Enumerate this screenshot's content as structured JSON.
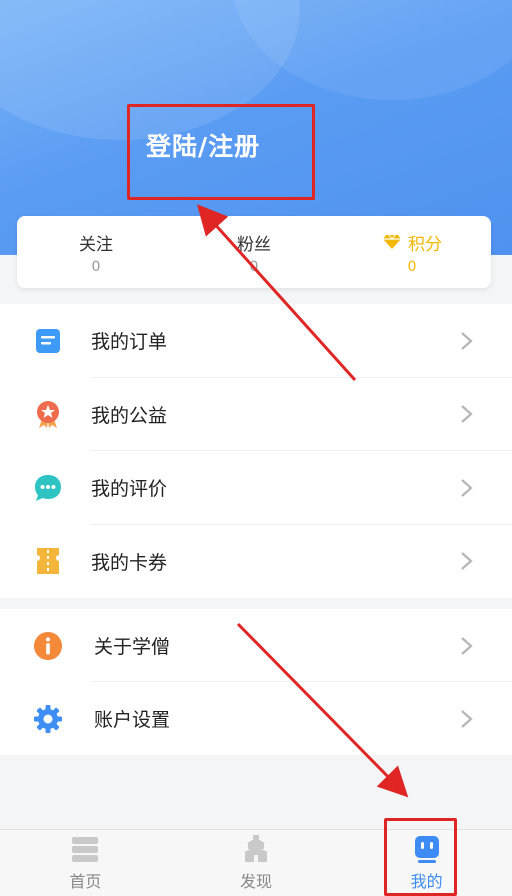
{
  "header": {
    "login_label": "登陆/注册"
  },
  "stats": [
    {
      "label": "关注",
      "value": "0"
    },
    {
      "label": "粉丝",
      "value": "0"
    },
    {
      "label": "积分",
      "value": "0",
      "icon": "diamond-icon"
    }
  ],
  "menu": {
    "group1": [
      {
        "label": "我的订单",
        "icon": "order-icon"
      },
      {
        "label": "我的公益",
        "icon": "charity-badge-icon"
      },
      {
        "label": "我的评价",
        "icon": "comment-bubble-icon"
      },
      {
        "label": "我的卡券",
        "icon": "ticket-icon"
      }
    ],
    "group2": [
      {
        "label": "关于学僧",
        "icon": "info-icon"
      },
      {
        "label": "账户设置",
        "icon": "gear-icon"
      }
    ]
  },
  "tabbar": [
    {
      "label": "首页",
      "icon": "home-stack-icon",
      "active": false
    },
    {
      "label": "发现",
      "icon": "discover-building-icon",
      "active": false
    },
    {
      "label": "我的",
      "icon": "robot-profile-icon",
      "active": true
    }
  ],
  "colors": {
    "header_blue": "#5a9cf3",
    "accent_gold": "#f2b705",
    "tab_active": "#3d8cf5",
    "annotation_red": "#e02525"
  }
}
